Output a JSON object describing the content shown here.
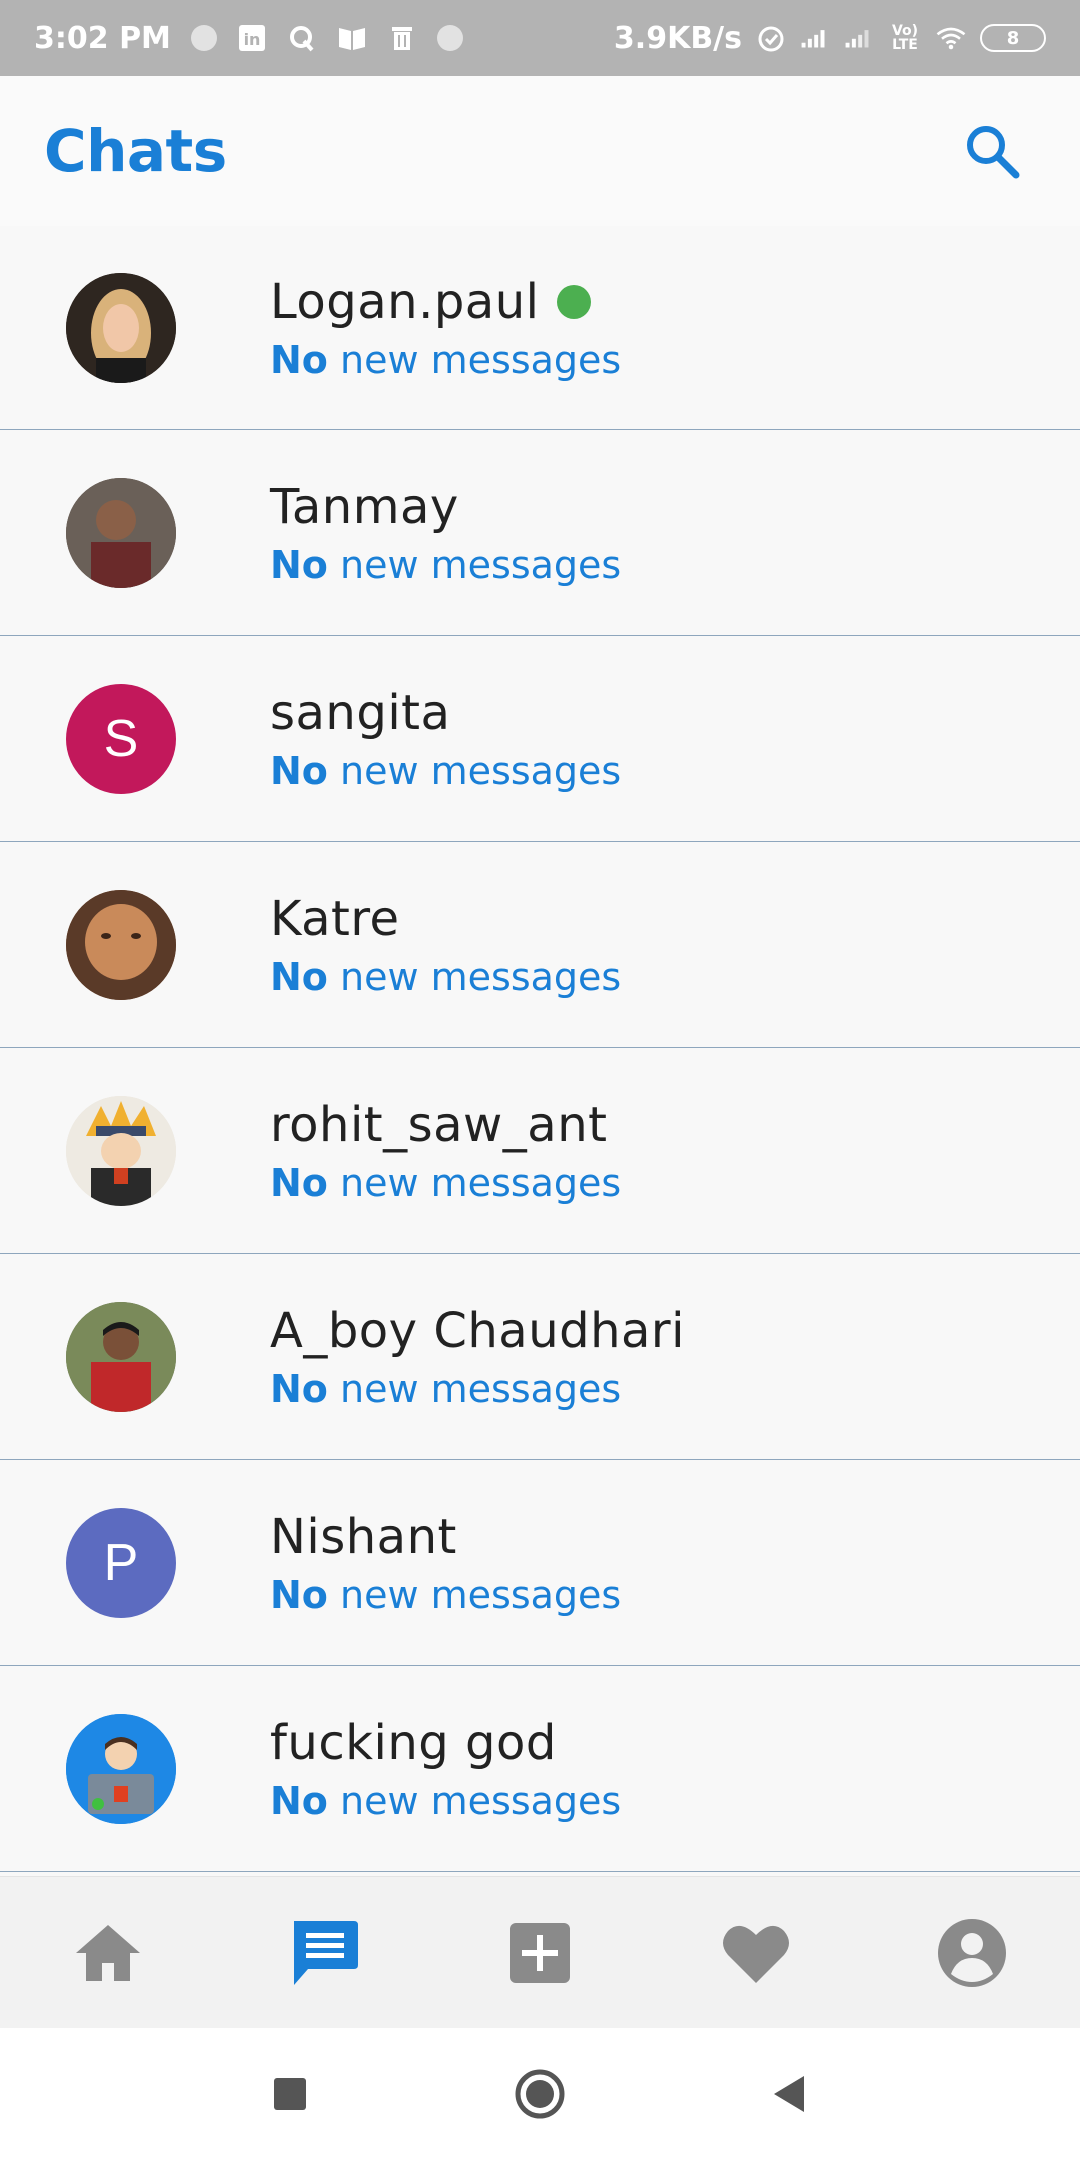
{
  "status_bar": {
    "time": "3:02 PM",
    "net_speed": "3.9KB/s",
    "volte": "Vo) LTE",
    "battery": "8"
  },
  "header": {
    "title": "Chats"
  },
  "chats": [
    {
      "name": "Logan.paul",
      "sub_bold": "No",
      "sub_rest": "new messages",
      "avatar_letter": "",
      "avatar_color": "#5a4a3a"
    },
    {
      "name": "Tanmay",
      "sub_bold": "No",
      "sub_rest": "new messages",
      "avatar_letter": "",
      "avatar_color": "#4a3a32"
    },
    {
      "name": "sangita",
      "sub_bold": "No",
      "sub_rest": "new messages",
      "avatar_letter": "S",
      "avatar_color": "#c2185b"
    },
    {
      "name": "Katre",
      "sub_bold": "No",
      "sub_rest": "new messages",
      "avatar_letter": "",
      "avatar_color": "#8a5a3a"
    },
    {
      "name": "rohit_saw_ant",
      "sub_bold": "No",
      "sub_rest": "new messages",
      "avatar_letter": "",
      "avatar_color": "#d9d2c6"
    },
    {
      "name": "A_boy Chaudhari",
      "sub_bold": "No",
      "sub_rest": "new messages",
      "avatar_letter": "",
      "avatar_color": "#5a6a4a"
    },
    {
      "name": "Nishant",
      "sub_bold": "No",
      "sub_rest": "new messages",
      "avatar_letter": "P",
      "avatar_color": "#5c6bc0"
    },
    {
      "name": "fucking god",
      "sub_bold": "No",
      "sub_rest": "new messages",
      "avatar_letter": "",
      "avatar_color": "#1e88e5"
    }
  ],
  "bottom_nav": [
    "home-icon",
    "chat-icon",
    "add-icon",
    "heart-icon",
    "profile-icon"
  ],
  "colors": {
    "accent": "#1a7fd6",
    "online": "#4caf50",
    "nav_inactive": "#8a8a8a"
  }
}
